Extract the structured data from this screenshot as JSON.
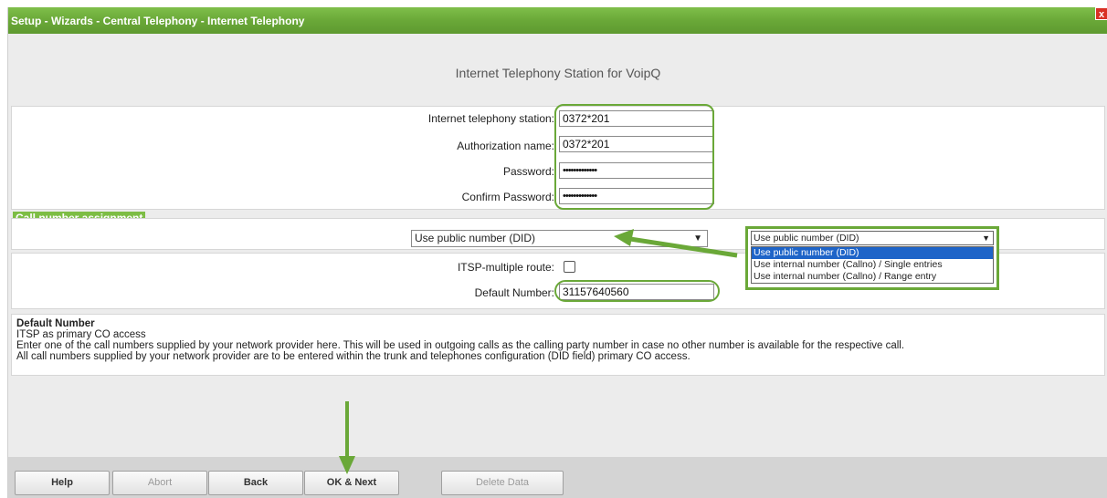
{
  "window": {
    "title": "Setup - Wizards - Central Telephony - Internet Telephony",
    "close_label": "x"
  },
  "page_title": "Internet Telephony Station for VoipQ",
  "fields": {
    "station_label": "Internet telephony station:",
    "station_value": "0372*201",
    "auth_label": "Authorization name:",
    "auth_value": "0372*201",
    "password_label": "Password:",
    "password_value": "•••••••••••••",
    "confirm_label": "Confirm Password:",
    "confirm_value": "•••••••••••••"
  },
  "call_assignment": {
    "section_title": "Call number assignment",
    "selected": "Use public number (DID)",
    "options": [
      "Use public number (DID)",
      "Use internal number (Callno) / Single entries",
      "Use internal number (Callno) / Range entry"
    ]
  },
  "routing": {
    "multiple_route_label": "ITSP-multiple route:",
    "multiple_route_checked": false,
    "default_number_label": "Default Number:",
    "default_number_value": "31157640560"
  },
  "help": {
    "heading": "Default Number",
    "line1": "ITSP as primary CO access",
    "line2": "Enter one of the call numbers supplied by your network provider here. This will be used in outgoing calls as the calling party number in case no other number is available for the respective call.",
    "line3": "All call numbers supplied by your network provider are to be entered within the trunk and telephones configuration (DID field) primary CO access."
  },
  "buttons": {
    "help": "Help",
    "abort": "Abort",
    "back": "Back",
    "ok_next": "OK & Next",
    "delete": "Delete Data"
  },
  "colors": {
    "accent_green": "#6aa838",
    "selection_blue": "#1e64c8"
  },
  "icons": [
    "close-icon",
    "chevron-down-icon",
    "annotation-arrow"
  ]
}
